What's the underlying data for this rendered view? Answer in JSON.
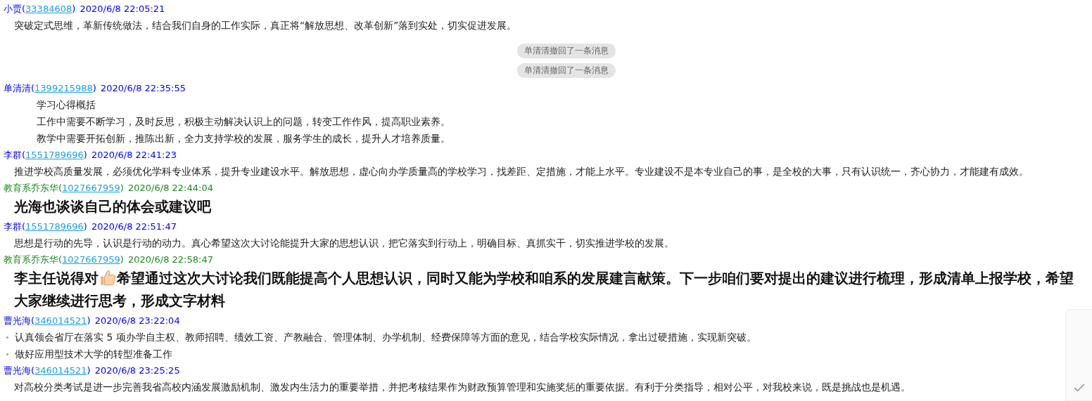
{
  "messages": [
    {
      "kind": "message",
      "sender": "小贾",
      "paren_open": "(",
      "qq": "33384608",
      "paren_close": ")",
      "time": "2020/6/8 22:05:21",
      "color": "#0000ff",
      "lines": [
        {
          "kind": "text",
          "text": "突破定式思维，革新传统做法，结合我们自身的工作实际，真正将“解放思想、改革创新”落到实处，切实促进发展。"
        }
      ]
    },
    {
      "kind": "notice",
      "text": "单清清撤回了一条消息"
    },
    {
      "kind": "notice",
      "text": "单清清撤回了一条消息"
    },
    {
      "kind": "message",
      "sender": "单清清",
      "paren_open": "(",
      "qq": "1399215988",
      "paren_close": ")",
      "time": "2020/6/8 22:35:55",
      "color": "#0000ff",
      "lines": [
        {
          "kind": "indented",
          "text": "学习心得概括"
        },
        {
          "kind": "indented",
          "text": "工作中需要不断学习，及时反思，积极主动解决认识上的问题，转变工作作风，提高职业素养。"
        },
        {
          "kind": "indented",
          "text": "教学中需要开拓创新，推陈出新，全力支持学校的发展，服务学生的成长，提升人才培养质量。"
        }
      ]
    },
    {
      "kind": "message",
      "sender": "李群",
      "paren_open": "(",
      "qq": "1551789696",
      "paren_close": ")",
      "time": "2020/6/8 22:41:23",
      "color": "#0000ff",
      "lines": [
        {
          "kind": "text",
          "text": "推进学校高质量发展，必须优化学科专业体系，提升专业建设水平。解放思想，虚心向办学质量高的学校学习，找差距、定措施，才能上水平。专业建设不是本专业自己的事，是全校的大事，只有认识统一，齐心协力，才能建有成效。"
        }
      ]
    },
    {
      "kind": "message",
      "sender": "教育系乔东华",
      "paren_open": "(",
      "qq": "1027667959",
      "paren_close": ")",
      "time": "2020/6/8 22:44:04",
      "color": "#1a8a1a",
      "lines": [
        {
          "kind": "big",
          "parts": [
            {
              "kind": "text",
              "text": "光海也谈谈自己的体会或建议吧"
            }
          ]
        }
      ]
    },
    {
      "kind": "message",
      "sender": "李群",
      "paren_open": "(",
      "qq": "1551789696",
      "paren_close": ")",
      "time": "2020/6/8 22:51:47",
      "color": "#0000ff",
      "lines": [
        {
          "kind": "text",
          "text": "思想是行动的先导，认识是行动的动力。真心希望这次大讨论能提升大家的思想认识，把它落实到行动上，明确目标、真抓实干，切实推进学校的发展。"
        }
      ]
    },
    {
      "kind": "message",
      "sender": "教育系乔东华",
      "paren_open": "(",
      "qq": "1027667959",
      "paren_close": ")",
      "time": "2020/6/8 22:58:47",
      "color": "#1a8a1a",
      "lines": [
        {
          "kind": "big",
          "parts": [
            {
              "kind": "text",
              "text": "李主任说得对"
            },
            {
              "kind": "thumbs_up"
            },
            {
              "kind": "text",
              "text": "希望通过这次大讨论我们既能提高个人思想认识，同时又能为学校和咱系的发展建言献策。下一步咱们要对提出的建议进行梳理，形成清单上报学校，希望"
            }
          ]
        },
        {
          "kind": "big",
          "parts": [
            {
              "kind": "text",
              "text": "大家继续进行思考，形成文字材料"
            }
          ]
        }
      ]
    },
    {
      "kind": "message",
      "sender": "曹光海",
      "paren_open": "(",
      "qq": "346014521",
      "paren_close": ")",
      "time": "2020/6/8 23:22:04",
      "color": "#0000ff",
      "lines": [
        {
          "kind": "bullet",
          "text": "认真领会省厅在落实 5 项办学自主权、教师招聘、绩效工资、产教融合、管理体制、办学机制、经费保障等方面的意见，结合学校实际情况，拿出过硬措施，实现新突破。"
        },
        {
          "kind": "bullet",
          "text": "做好应用型技术大学的转型准备工作"
        }
      ]
    },
    {
      "kind": "message",
      "sender": "曹光海",
      "paren_open": "(",
      "qq": "346014521",
      "paren_close": ")",
      "time": "2020/6/8 23:25:25",
      "color": "#0000ff",
      "lines": [
        {
          "kind": "text",
          "text": "对高校分类考试是进一步完善我省高校内涵发展激励机制、激发内生活力的重要举措，并把考核结果作为财政预算管理和实施奖惩的重要依据。有利于分类指导，相对公平，对我校来说，既是挑战也是机遇。"
        }
      ]
    }
  ]
}
